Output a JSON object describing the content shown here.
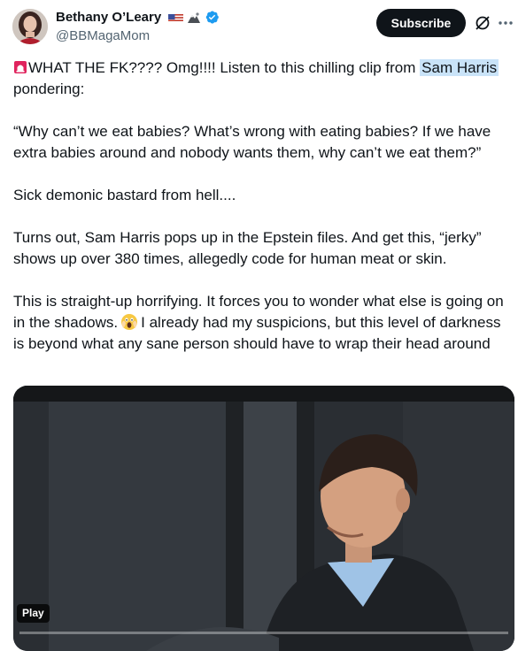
{
  "author": {
    "name": "Bethany O’Leary",
    "handle": "@BBMagaMom",
    "flag_icon": "us-flag-icon",
    "badge_icon": "mountain-icon",
    "verified_icon": "verified-badge-icon",
    "verified_color": "#1d9bf0"
  },
  "actions": {
    "subscribe_label": "Subscribe",
    "grok_icon": "grok-icon",
    "more_icon": "more-icon"
  },
  "tweet": {
    "p1_emoji": "siren-icon",
    "p1_before": "WHAT THE FK???? Omg!!!! Listen to this chilling clip from ",
    "p1_highlight": "Sam Harris",
    "p1_after": " pondering:",
    "p2": "“Why can’t we eat babies? What’s wrong with eating babies? If we have extra babies around and nobody wants them, why can’t we eat them?”",
    "p3": "Sick demonic bastard from hell....",
    "p4": "Turns out, Sam Harris pops up in the Epstein files. And get this, “jerky” shows up over 380 times, allegedly code for human meat or skin.",
    "p5_before": "This is straight-up horrifying. It forces you to wonder what else is going on in the shadows.",
    "p5_emoji": "scream-face-icon",
    "p5_after": "I already had my suspicions, but this level of darkness is beyond what any sane person should have to wrap their head around"
  },
  "video": {
    "play_label": "Play",
    "progress": 0
  },
  "colors": {
    "text": "#0f1419",
    "secondary": "#536471",
    "highlight": "#c9e3f8"
  }
}
